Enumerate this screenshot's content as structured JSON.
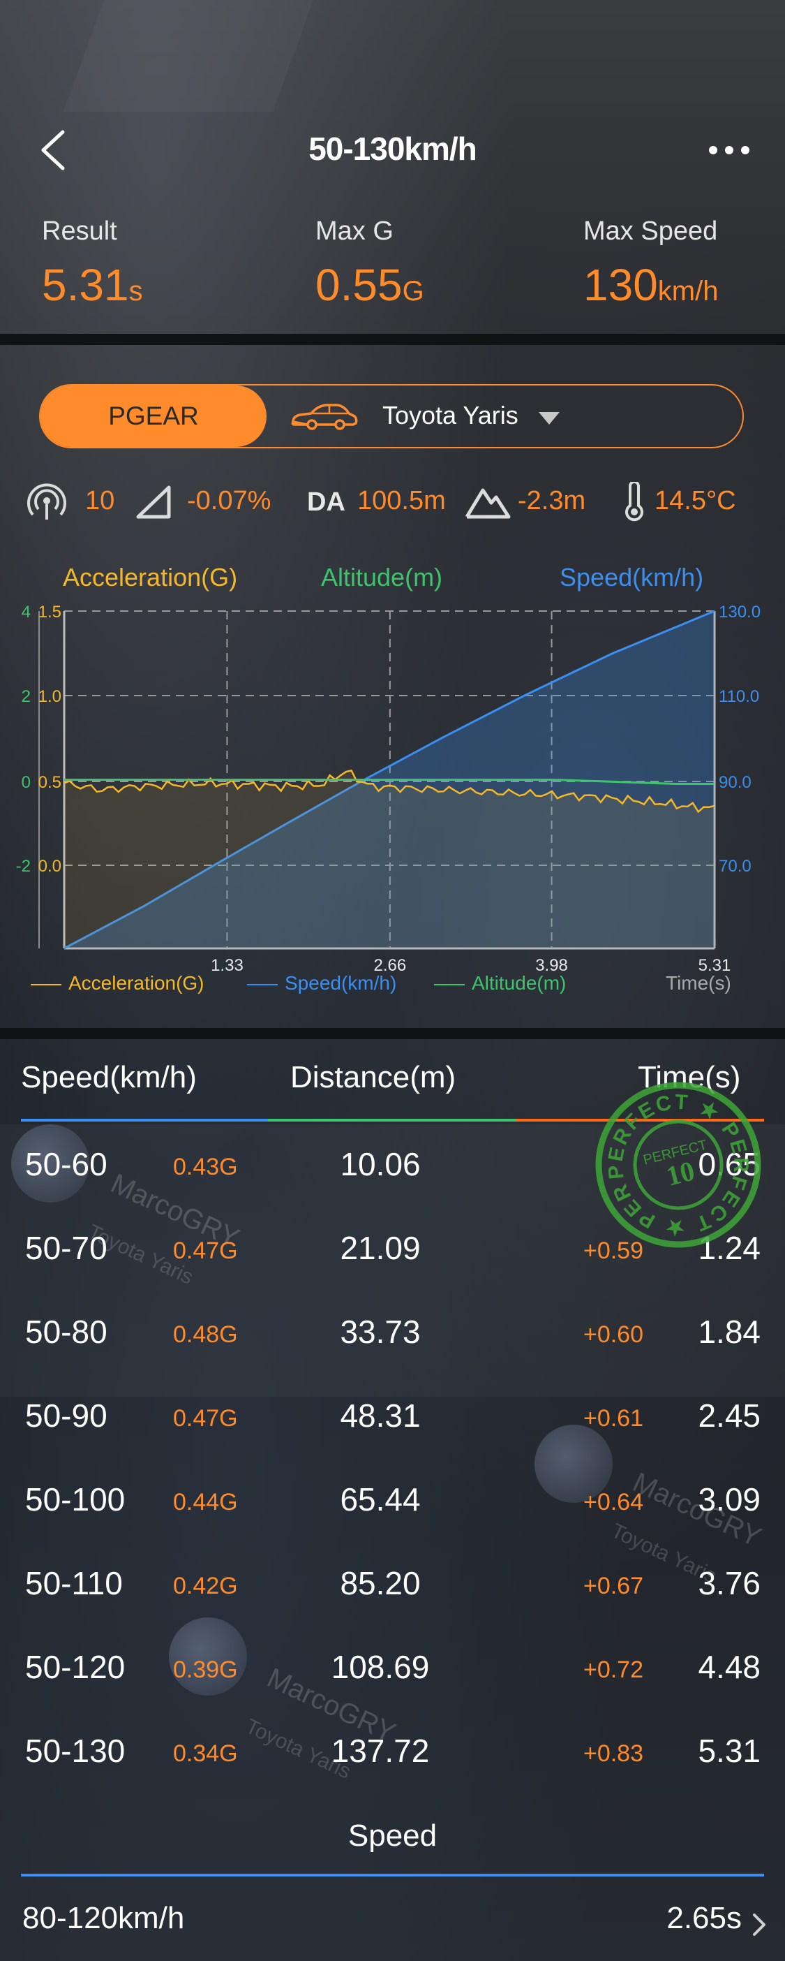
{
  "header": {
    "title": "50-130km/h",
    "stats": [
      {
        "label": "Result",
        "value": "5.31",
        "unit": "s"
      },
      {
        "label": "Max G",
        "value": "0.55",
        "unit": "G"
      },
      {
        "label": "Max Speed",
        "value": "130",
        "unit": "km/h"
      }
    ]
  },
  "device": {
    "brand_label": "PGEAR",
    "car_name": "Toyota Yaris"
  },
  "metrics": {
    "satellites": "10",
    "slope": "-0.07%",
    "da_label": "DA",
    "da_value": "100.5m",
    "elevation": "-2.3m",
    "temperature": "14.5°C"
  },
  "colors": {
    "accent": "#ff8b2a",
    "speed": "#3a8ff0",
    "altitude": "#3ec46d",
    "acceleration": "#f5b82a"
  },
  "chart_data": {
    "type": "line",
    "title": "",
    "x": [
      0,
      0.59,
      1.24,
      1.84,
      2.45,
      3.09,
      3.76,
      4.48,
      5.31
    ],
    "xlabel": "Time(s)",
    "x_ticks": [
      "1.33",
      "2.66",
      "3.98",
      "5.31"
    ],
    "xlim": [
      0,
      5.31
    ],
    "grid": true,
    "series": [
      {
        "name": "Speed(km/h)",
        "axis": "right",
        "ylim": [
          50,
          130
        ],
        "tick_labels": [
          "130.0",
          "110.0",
          "90.0",
          "70.0"
        ],
        "x": [
          0,
          0.65,
          1.24,
          1.84,
          2.45,
          3.09,
          3.76,
          4.48,
          5.31
        ],
        "values": [
          50,
          60,
          70,
          80,
          90,
          100,
          110,
          120,
          130
        ]
      },
      {
        "name": "Acceleration(G)",
        "axis": "left-inner",
        "tick_labels": [
          "1.5",
          "1.0",
          "0.5",
          "0.0"
        ],
        "x": [
          0,
          0.3,
          0.6,
          0.9,
          1.2,
          1.5,
          1.8,
          2.1,
          2.3,
          2.5,
          2.8,
          3.1,
          3.4,
          3.7,
          4.0,
          4.3,
          4.6,
          4.9,
          5.1,
          5.31
        ],
        "values": [
          0.48,
          0.44,
          0.46,
          0.47,
          0.48,
          0.47,
          0.46,
          0.47,
          0.55,
          0.46,
          0.45,
          0.44,
          0.43,
          0.42,
          0.41,
          0.4,
          0.38,
          0.36,
          0.34,
          0.33
        ]
      },
      {
        "name": "Altitude(m)",
        "axis": "left-outer",
        "tick_labels": [
          "4",
          "2",
          "0",
          "-2"
        ],
        "x": [
          0,
          1,
          2,
          3,
          4,
          5,
          5.31
        ],
        "values": [
          0,
          0,
          0,
          0,
          0,
          -0.1,
          -0.1
        ]
      }
    ]
  },
  "table": {
    "headers": {
      "speed": "Speed(km/h)",
      "distance": "Distance(m)",
      "time": "Time(s)"
    },
    "rows": [
      {
        "range": "50-60",
        "g": "0.43G",
        "distance": "10.06",
        "diff": "",
        "time": "0.65"
      },
      {
        "range": "50-70",
        "g": "0.47G",
        "distance": "21.09",
        "diff": "+0.59",
        "time": "1.24"
      },
      {
        "range": "50-80",
        "g": "0.48G",
        "distance": "33.73",
        "diff": "+0.60",
        "time": "1.84"
      },
      {
        "range": "50-90",
        "g": "0.47G",
        "distance": "48.31",
        "diff": "+0.61",
        "time": "2.45"
      },
      {
        "range": "50-100",
        "g": "0.44G",
        "distance": "65.44",
        "diff": "+0.64",
        "time": "3.09"
      },
      {
        "range": "50-110",
        "g": "0.42G",
        "distance": "85.20",
        "diff": "+0.67",
        "time": "3.76"
      },
      {
        "range": "50-120",
        "g": "0.39G",
        "distance": "108.69",
        "diff": "+0.72",
        "time": "4.48"
      },
      {
        "range": "50-130",
        "g": "0.34G",
        "distance": "137.72",
        "diff": "+0.83",
        "time": "5.31"
      }
    ]
  },
  "stamp": {
    "text": "PERFECT",
    "number": "10"
  },
  "watermark": {
    "name": "MarcoGRY",
    "car": "Toyota Yaris"
  },
  "speed_section": {
    "title": "Speed",
    "items": [
      {
        "range": "80-120km/h",
        "time": "2.65s"
      }
    ]
  }
}
